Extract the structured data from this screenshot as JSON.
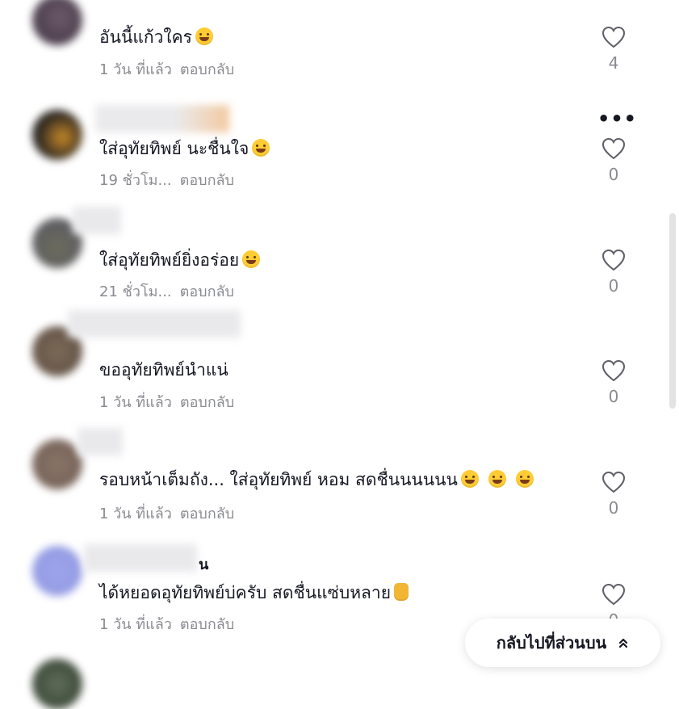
{
  "comments": [
    {
      "text": "อันนี้แก้วใคร",
      "emoji": "rolling-laughing-emoji",
      "time": "1 วัน ที่แล้ว",
      "reply": "ตอบกลับ",
      "likes": "4",
      "name_tail": ""
    },
    {
      "text": "ใส่อุทัยทิพย์ นะชื่นใจ",
      "emoji": "tears-of-joy-emoji",
      "time": "19 ชั่วโม...",
      "reply": "ตอบกลับ",
      "likes": "0",
      "name_tail": ""
    },
    {
      "text": "ใส่อุทัยทิพย์ยิ่งอร่อย",
      "emoji": "sweat-smile-emoji",
      "time": "21 ชั่วโม...",
      "reply": "ตอบกลับ",
      "likes": "0",
      "name_tail": ""
    },
    {
      "text": "ขออุทัยทิพย์นำแน่",
      "emoji": "",
      "time": "1 วัน ที่แล้ว",
      "reply": "ตอบกลับ",
      "likes": "0",
      "name_tail": ""
    },
    {
      "text": "รอบหน้าเต็มถัง... ใส่อุทัยทิพย์ หอม สดชื่นนนนนน",
      "emoji": "grin-emoji x3",
      "time": "1 วัน ที่แล้ว",
      "reply": "ตอบกลับ",
      "likes": "0",
      "name_tail": ""
    },
    {
      "text": "ได้หยอดอุทัยทิพย์บ่ครับ สดชื่นแซ่บหลาย",
      "emoji": "thumbs-up-emoji",
      "time": "1 วัน ที่แล้ว",
      "reply": "ตอบกลับ",
      "likes": "0",
      "name_tail": "น"
    }
  ],
  "more_label": "•••",
  "back_to_top": {
    "label": "กลับไปที่ส่วนบน",
    "icon": "double-chevron-up-icon"
  },
  "colors": {
    "text": "#161823",
    "muted": "#8a8b91",
    "background": "#ffffff"
  }
}
